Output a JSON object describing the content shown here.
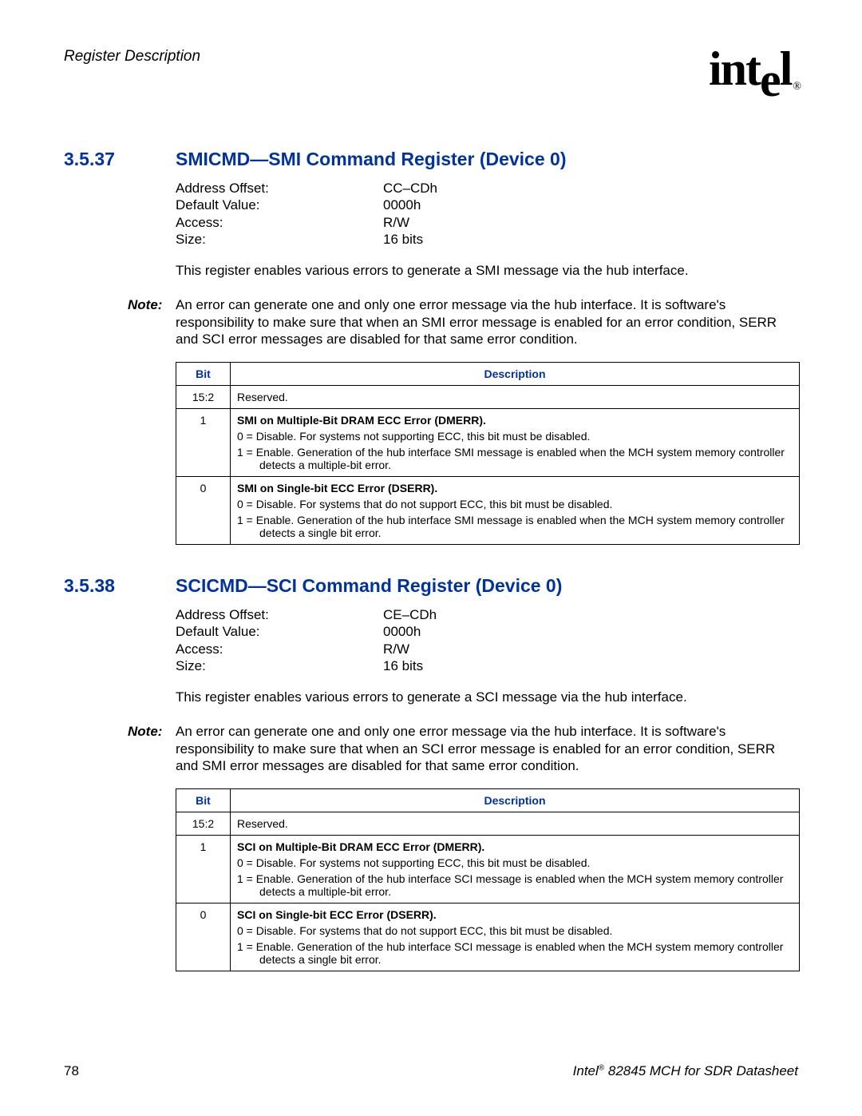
{
  "header": {
    "section_label": "Register Description",
    "logo_text_1": "int",
    "logo_text_drop": "e",
    "logo_text_2": "l",
    "logo_reg": "®"
  },
  "sections": [
    {
      "num": "3.5.37",
      "title": "SMICMD—SMI Command Register (Device 0)",
      "attrs": [
        {
          "label": "Address Offset:",
          "value": "CC–CDh"
        },
        {
          "label": "Default Value:",
          "value": "0000h"
        },
        {
          "label": "Access:",
          "value": "R/W"
        },
        {
          "label": "Size:",
          "value": "16 bits"
        }
      ],
      "paragraph": "This register enables various errors to generate a SMI message via the hub interface.",
      "note_label": "Note:",
      "note": "An error can generate one and only one error message via the hub interface. It is software's responsibility to make sure that when an SMI error message is enabled for an error condition, SERR and SCI error messages are disabled for that same error condition.",
      "table": {
        "col_bit": "Bit",
        "col_desc": "Description",
        "rows": [
          {
            "bit": "15:2",
            "desc_title": "",
            "desc_lines": [
              "Reserved."
            ]
          },
          {
            "bit": "1",
            "desc_title": "SMI on Multiple-Bit DRAM ECC Error (DMERR).",
            "desc_lines": [
              "0 = Disable. For systems not supporting ECC, this bit must be disabled.",
              "1 = Enable. Generation of the hub interface SMI message is enabled when the MCH system memory controller detects a multiple-bit error."
            ]
          },
          {
            "bit": "0",
            "desc_title": "SMI on Single-bit ECC Error (DSERR).",
            "desc_lines": [
              "0 = Disable. For systems that do not support ECC, this bit must be disabled.",
              "1 = Enable. Generation of the hub interface SMI message is enabled when the MCH system memory controller detects a single bit error."
            ]
          }
        ]
      }
    },
    {
      "num": "3.5.38",
      "title": "SCICMD—SCI Command Register (Device 0)",
      "attrs": [
        {
          "label": "Address Offset:",
          "value": "CE–CDh"
        },
        {
          "label": "Default Value:",
          "value": "0000h"
        },
        {
          "label": "Access:",
          "value": "R/W"
        },
        {
          "label": "Size:",
          "value": "16 bits"
        }
      ],
      "paragraph": "This register enables various errors to generate a SCI message via the hub interface.",
      "note_label": "Note:",
      "note": "An error can generate one and only one error message via the hub interface. It is software's responsibility to make sure that when an SCI error message is enabled for an error condition, SERR and SMI error messages are disabled for that same error condition.",
      "table": {
        "col_bit": "Bit",
        "col_desc": "Description",
        "rows": [
          {
            "bit": "15:2",
            "desc_title": "",
            "desc_lines": [
              "Reserved."
            ]
          },
          {
            "bit": "1",
            "desc_title": "SCI on Multiple-Bit DRAM ECC Error (DMERR).",
            "desc_lines": [
              "0 = Disable. For systems not supporting ECC, this bit must be disabled.",
              "1 = Enable. Generation of the hub interface SCI message is enabled when the MCH system memory controller detects a multiple-bit error."
            ]
          },
          {
            "bit": "0",
            "desc_title": "SCI on Single-bit ECC Error (DSERR).",
            "desc_lines": [
              "0 = Disable. For systems that do not support ECC, this bit must be disabled.",
              "1 = Enable. Generation of the hub interface SCI message is enabled when the MCH system memory controller detects a single bit error."
            ]
          }
        ]
      }
    }
  ],
  "footer": {
    "page": "78",
    "doc_pre": "Intel",
    "doc_sup": "®",
    "doc_post": " 82845 MCH for SDR Datasheet"
  }
}
